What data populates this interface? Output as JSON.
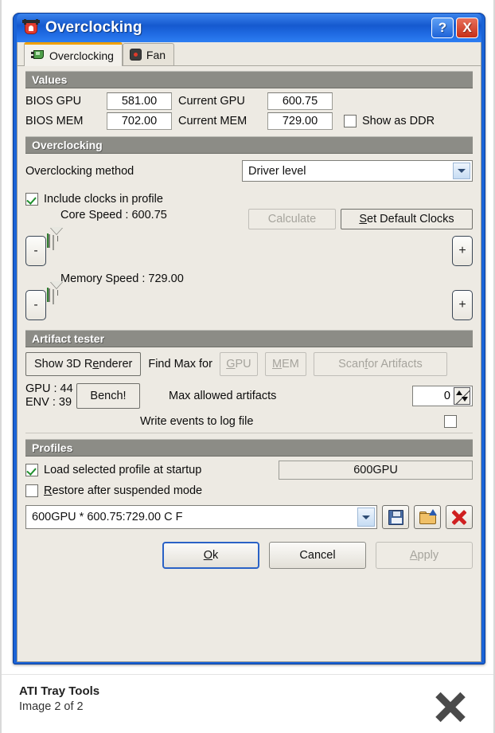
{
  "window": {
    "title": "Overclocking",
    "icon": "ati-tray-tools-icon",
    "help_label": "?",
    "close_label": "X"
  },
  "tabs": [
    {
      "label": "Overclocking",
      "icon": "video-card-icon",
      "active": true
    },
    {
      "label": "Fan",
      "icon": "fan-icon",
      "active": false
    }
  ],
  "values": {
    "group_title": "Values",
    "bios_gpu_label": "BIOS GPU",
    "bios_gpu_value": "581.00",
    "bios_mem_label": "BIOS MEM",
    "bios_mem_value": "702.00",
    "current_gpu_label": "Current GPU",
    "current_gpu_value": "600.75",
    "current_mem_label": "Current MEM",
    "current_mem_value": "729.00",
    "show_as_ddr_label": "Show as DDR",
    "show_as_ddr_checked": false
  },
  "overclocking": {
    "group_title": "Overclocking",
    "method_label": "Overclocking method",
    "method_value": "Driver level",
    "include_clocks_label": "Include clocks in profile",
    "include_clocks_checked": true,
    "core_speed_label": "Core Speed : 600.75",
    "memory_speed_label": "Memory Speed : 729.00",
    "calculate_label": "Calculate",
    "calculate_disabled": true,
    "set_default_clocks_label": "Set Default Clocks",
    "minus_label": "-",
    "plus_label": "+",
    "core_slider_percent": 35,
    "memory_slider_percent": 35,
    "tick_count": 25
  },
  "artifact_tester": {
    "group_title": "Artifact tester",
    "show_3d_renderer_label": "Show 3D Renderer",
    "find_max_for_label": "Find Max for",
    "gpu_button_label": "GPU",
    "mem_button_label": "MEM",
    "scan_label": "Scan for Artifacts",
    "gpu_temp_label": "GPU : 44",
    "env_temp_label": "ENV : 39",
    "bench_label": "Bench!",
    "max_artifacts_label": "Max allowed artifacts",
    "max_artifacts_value": "0",
    "write_events_label": "Write events to log file",
    "write_events_checked": false
  },
  "profiles": {
    "group_title": "Profiles",
    "load_at_startup_label": "Load selected profile at startup",
    "load_at_startup_checked": true,
    "startup_profile_value": "600GPU",
    "restore_suspended_label": "Restore after suspended mode",
    "restore_suspended_checked": false,
    "selected_profile": "600GPU * 600.75:729.00 C  F",
    "save_icon": "floppy-save-icon",
    "open_icon": "folder-open-icon",
    "delete_icon": "red-x-delete-icon"
  },
  "dialog_buttons": {
    "ok_label": "Ok",
    "cancel_label": "Cancel",
    "apply_label": "Apply",
    "apply_disabled": true
  },
  "footer": {
    "app_name": "ATI Tray Tools",
    "image_counter": "Image 2 of 2",
    "close_icon": "close-x-icon"
  },
  "colors": {
    "title_bar_blue": "#1559cf",
    "group_bar_gray": "#8c8c86",
    "accent_orange": "#f0a000",
    "check_green": "#1f8f2c",
    "delete_red": "#cf2020"
  }
}
